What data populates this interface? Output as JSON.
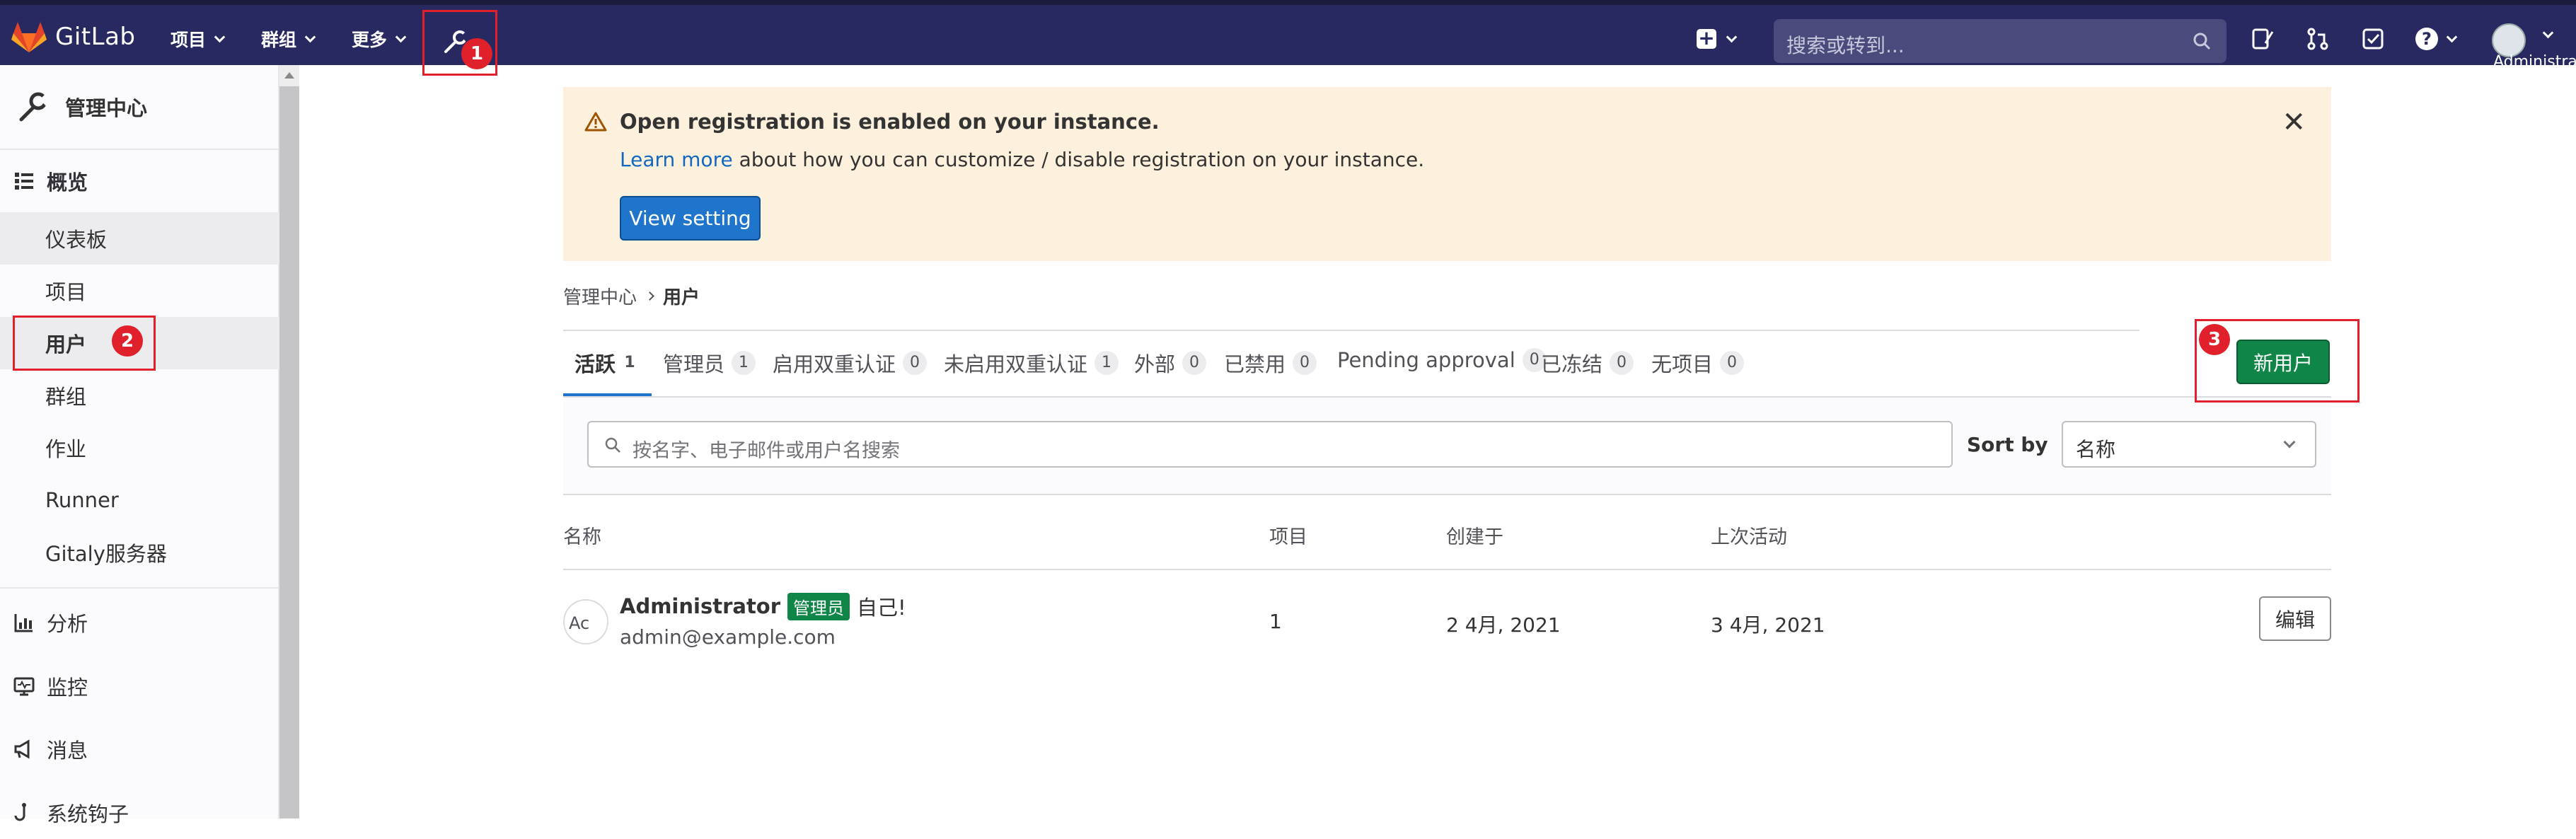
{
  "app": {
    "name": "GitLab"
  },
  "topbar": {
    "nav": [
      {
        "label": "项目"
      },
      {
        "label": "群组"
      },
      {
        "label": "更多"
      }
    ],
    "search_placeholder": "搜索或转到...",
    "user_name": "Administrator"
  },
  "annotations": [
    "1",
    "2",
    "3"
  ],
  "sidebar": {
    "title": "管理中心",
    "sections": [
      {
        "label": "概览",
        "icon": "overview-icon"
      },
      {
        "label": "分析",
        "icon": "analytics-icon"
      },
      {
        "label": "监控",
        "icon": "monitor-icon"
      },
      {
        "label": "消息",
        "icon": "messages-icon"
      },
      {
        "label": "系统钩子",
        "icon": "hook-icon"
      }
    ],
    "subitems": [
      {
        "label": "仪表板"
      },
      {
        "label": "项目"
      },
      {
        "label": "用户"
      },
      {
        "label": "群组"
      },
      {
        "label": "作业"
      },
      {
        "label": "Runner"
      },
      {
        "label": "Gitaly服务器"
      }
    ]
  },
  "alert": {
    "title": "Open registration is enabled on your instance.",
    "link_text": "Learn more",
    "body_rest": " about how you can customize / disable registration on your instance.",
    "button": "View setting"
  },
  "breadcrumb": {
    "parent": "管理中心",
    "current": "用户"
  },
  "tabs": [
    {
      "label": "活跃",
      "count": "1"
    },
    {
      "label": "管理员",
      "count": "1"
    },
    {
      "label": "启用双重认证",
      "count": "0"
    },
    {
      "label": "未启用双重认证",
      "count": "1"
    },
    {
      "label": "外部",
      "count": "0"
    },
    {
      "label": "已禁用",
      "count": "0"
    },
    {
      "label": "Pending approval",
      "count": "0"
    },
    {
      "label": "已冻结",
      "count": "0"
    },
    {
      "label": "无项目",
      "count": "0"
    }
  ],
  "new_user_button": "新用户",
  "filter": {
    "placeholder": "按名字、电子邮件或用户名搜索",
    "sort_label": "Sort by",
    "sort_value": "名称"
  },
  "table": {
    "headers": [
      "名称",
      "项目",
      "创建于",
      "上次活动"
    ],
    "rows": [
      {
        "avatar_alt": "Ac",
        "name": "Administrator",
        "badge": "管理员",
        "self": "自己!",
        "email": "admin@example.com",
        "projects": "1",
        "created": "2 4月, 2021",
        "last_activity": "3 4月, 2021",
        "action": "编辑"
      }
    ]
  },
  "colors": {
    "topbar": "#292961",
    "primary": "#1f75cb",
    "success": "#108548",
    "alert_bg": "#fdf1dd",
    "annotation": "#e0212b"
  }
}
